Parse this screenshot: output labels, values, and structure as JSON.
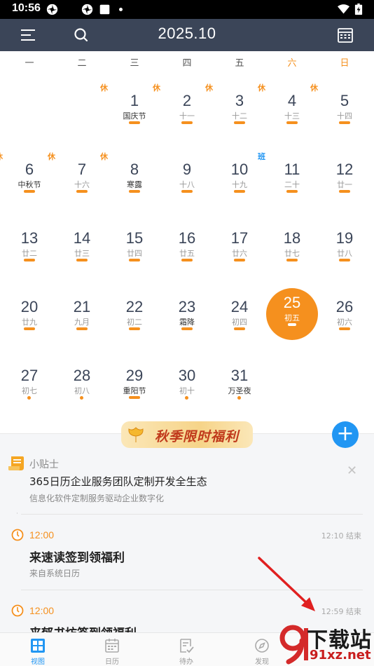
{
  "status_bar": {
    "time": "10:56"
  },
  "header": {
    "title": "2025.10"
  },
  "weekdays": [
    "一",
    "二",
    "三",
    "四",
    "五",
    "六",
    "日"
  ],
  "calendar": {
    "weeks": [
      [
        null,
        null,
        {
          "day": "1",
          "lunar": "国庆节",
          "badge": "休",
          "mark": "bar",
          "lunar_holiday": true
        },
        {
          "day": "2",
          "lunar": "十一",
          "badge": "休",
          "mark": "bar"
        },
        {
          "day": "3",
          "lunar": "十二",
          "badge": "休",
          "mark": "bar"
        },
        {
          "day": "4",
          "lunar": "十三",
          "badge": "休",
          "mark": "bar"
        },
        {
          "day": "5",
          "lunar": "十四",
          "badge": "休",
          "mark": "bar"
        }
      ],
      [
        {
          "day": "6",
          "lunar": "中秋节",
          "badge": "休",
          "mark": "bar",
          "lunar_holiday": true
        },
        {
          "day": "7",
          "lunar": "十六",
          "badge": "休",
          "mark": "bar"
        },
        {
          "day": "8",
          "lunar": "寒露",
          "badge": "休",
          "mark": "bar",
          "lunar_holiday": true
        },
        {
          "day": "9",
          "lunar": "十八",
          "mark": "bar"
        },
        {
          "day": "10",
          "lunar": "十九",
          "mark": "bar"
        },
        {
          "day": "11",
          "lunar": "二十",
          "badge": "班",
          "badge_type": "work",
          "mark": "bar"
        },
        {
          "day": "12",
          "lunar": "廿一",
          "mark": "bar"
        }
      ],
      [
        {
          "day": "13",
          "lunar": "廿二",
          "mark": "bar"
        },
        {
          "day": "14",
          "lunar": "廿三",
          "mark": "bar"
        },
        {
          "day": "15",
          "lunar": "廿四",
          "mark": "bar"
        },
        {
          "day": "16",
          "lunar": "廿五",
          "mark": "bar"
        },
        {
          "day": "17",
          "lunar": "廿六",
          "mark": "bar"
        },
        {
          "day": "18",
          "lunar": "廿七",
          "mark": "bar"
        },
        {
          "day": "19",
          "lunar": "廿八",
          "mark": "bar"
        }
      ],
      [
        {
          "day": "20",
          "lunar": "廿九",
          "mark": "bar"
        },
        {
          "day": "21",
          "lunar": "九月",
          "mark": "bar"
        },
        {
          "day": "22",
          "lunar": "初二",
          "mark": "bar"
        },
        {
          "day": "23",
          "lunar": "霜降",
          "mark": "bar",
          "lunar_holiday": true
        },
        {
          "day": "24",
          "lunar": "初四",
          "mark": "bar"
        },
        {
          "day": "25",
          "lunar": "初五",
          "mark": "bar",
          "today": true
        },
        {
          "day": "26",
          "lunar": "初六",
          "mark": "bar"
        }
      ],
      [
        {
          "day": "27",
          "lunar": "初七",
          "mark": "dot"
        },
        {
          "day": "28",
          "lunar": "初八",
          "mark": "dot"
        },
        {
          "day": "29",
          "lunar": "重阳节",
          "mark": "bar",
          "lunar_holiday": true
        },
        {
          "day": "30",
          "lunar": "初十",
          "mark": "dot"
        },
        {
          "day": "31",
          "lunar": "万圣夜",
          "mark": "dot",
          "lunar_holiday": true
        },
        null,
        null
      ]
    ]
  },
  "banner": {
    "text": "秋季限时福利"
  },
  "tip": {
    "label": "小贴士",
    "title": "365日历企业服务团队定制开发全生态",
    "subtitle": "信息化软件定制服务驱动企业数字化"
  },
  "events": [
    {
      "time": "12:00",
      "end": "12:10 结束",
      "title": "来速读签到领福利",
      "subtitle": "来自系统日历"
    },
    {
      "time": "12:00",
      "end": "12:59 结束",
      "title": "来郁书坊签到领福利",
      "subtitle": ""
    }
  ],
  "bottom_nav": [
    {
      "label": "视图",
      "icon": "grid-view-icon",
      "active": true
    },
    {
      "label": "日历",
      "icon": "calendar-icon"
    },
    {
      "label": "待办",
      "icon": "todo-icon"
    },
    {
      "label": "发现",
      "icon": "discover-icon"
    }
  ],
  "watermark": {
    "top": "下载站",
    "bottom": "91xz.net"
  },
  "colors": {
    "header": "#3b4558",
    "accent": "#f5901e",
    "blue": "#2196f3"
  }
}
